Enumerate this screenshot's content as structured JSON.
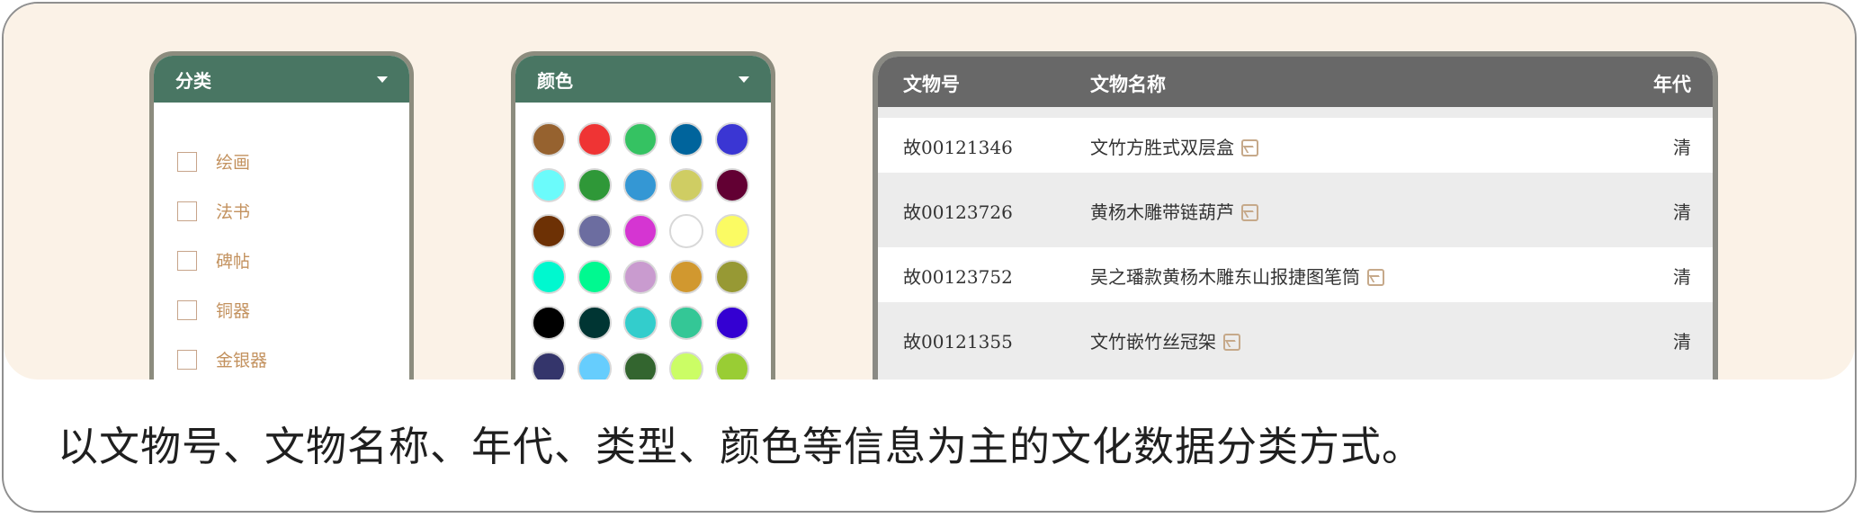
{
  "category_panel": {
    "title": "分类",
    "items": [
      {
        "label": "绘画"
      },
      {
        "label": "法书"
      },
      {
        "label": "碑帖"
      },
      {
        "label": "铜器"
      },
      {
        "label": "金银器"
      }
    ]
  },
  "color_panel": {
    "title": "颜色",
    "swatches": [
      "#96622f",
      "#ef3434",
      "#35c262",
      "#00649c",
      "#3a36d3",
      "#6bfbfb",
      "#2f9838",
      "#3497d4",
      "#cfcd63",
      "#620033",
      "#6d3105",
      "#6c6da0",
      "#d535d2",
      "#ffffff",
      "#fbfb63",
      "#00f8cf",
      "#00f990",
      "#c99bcf",
      "#d1982f",
      "#979934",
      "#000000",
      "#003533",
      "#33cdcc",
      "#34c796",
      "#3400d2",
      "#34356b",
      "#66cdfd",
      "#33652f",
      "#cbfd65",
      "#99cd34"
    ]
  },
  "table": {
    "headers": {
      "id": "文物号",
      "name": "文物名称",
      "era": "年代"
    },
    "rows": [
      {
        "id": "故00121346",
        "name": "文竹方胜式双层盒",
        "era": "清"
      },
      {
        "id": "故00123726",
        "name": "黄杨木雕带链葫芦",
        "era": "清"
      },
      {
        "id": "故00123752",
        "name": "吴之璠款黄杨木雕东山报捷图笔筒",
        "era": "清"
      },
      {
        "id": "故00121355",
        "name": "文竹嵌竹丝冠架",
        "era": "清"
      }
    ]
  },
  "caption": "以文物号、文物名称、年代、类型、颜色等信息为主的文化数据分类方式。",
  "colors": {
    "panel_header": "#497663",
    "table_header": "#686868",
    "background": "#fbf2e7",
    "category_text": "#c3925f"
  }
}
